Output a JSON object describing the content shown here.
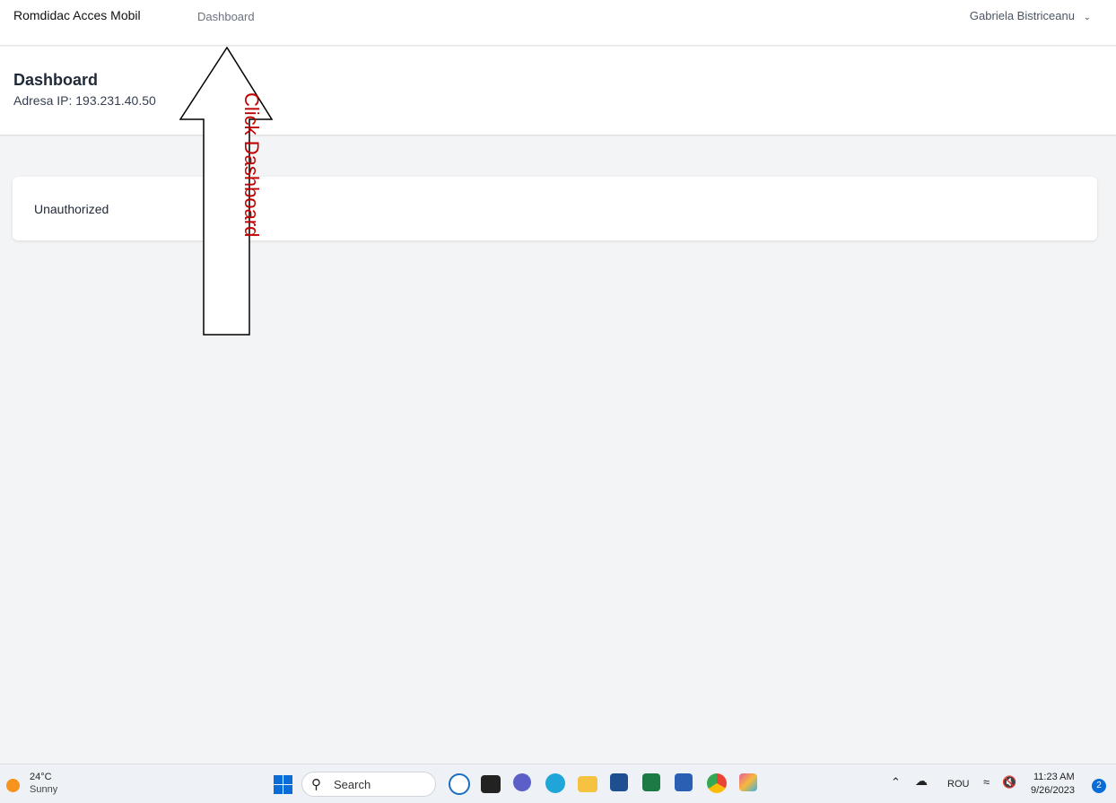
{
  "topnav": {
    "brand": "Romdidac Acces Mobil",
    "nav_dashboard": "Dashboard",
    "user_name": "Gabriela Bistriceanu"
  },
  "header": {
    "title": "Dashboard",
    "ip_line": "Adresa IP: 193.231.40.50"
  },
  "content": {
    "message": "Unauthorized"
  },
  "annotation": {
    "text": "Click Dashboard",
    "color": "#c00000"
  },
  "taskbar": {
    "weather_temp": "24°C",
    "weather_condition": "Sunny",
    "search_label": "Search",
    "apps": [
      "bing-icon",
      "app-icon",
      "meet-icon",
      "edge-icon",
      "file-explorer-icon",
      "store-icon",
      "excel-icon",
      "word-icon",
      "chrome-icon",
      "photos-icon"
    ],
    "tray_lang": "ROU",
    "time": "11:23 AM",
    "date": "9/26/2023",
    "notification_count": "2"
  }
}
